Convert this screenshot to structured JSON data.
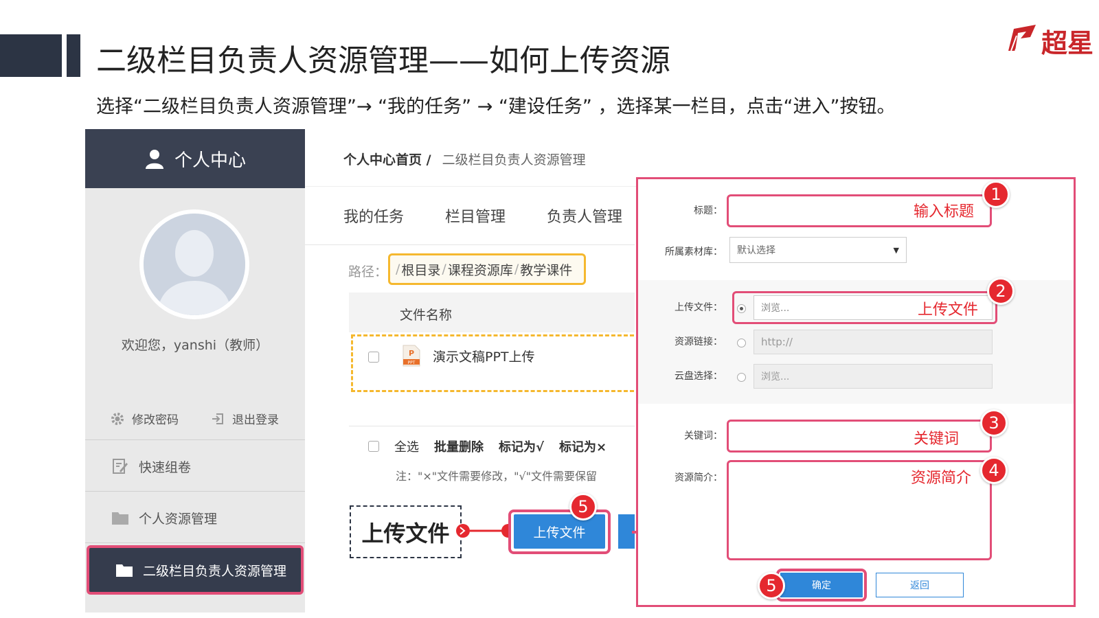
{
  "slide": {
    "title": "二级栏目负责人资源管理——如何上传资源",
    "instruction": "选择“二级栏目负责人资源管理”→ “我的任务” → “建设任务” ，选择某一栏目，点击“进入”按钮。",
    "logo_text": "超星",
    "brand_color": "#c9262a"
  },
  "sidebar": {
    "header": "个人中心",
    "welcome": "欢迎您，yanshi（教师）",
    "change_password": "修改密码",
    "logout": "退出登录",
    "items": [
      {
        "label": "快速组卷",
        "icon": "edit-icon"
      },
      {
        "label": "个人资源管理",
        "icon": "folder-icon"
      },
      {
        "label": "二级栏目负责人资源管理",
        "icon": "folder-icon",
        "active": true
      }
    ]
  },
  "breadcrumb": {
    "home": "个人中心首页 /",
    "current": "二级栏目负责人资源管理"
  },
  "tabs": [
    "我的任务",
    "栏目管理",
    "负责人管理"
  ],
  "path": {
    "label": "路径：",
    "segments": [
      "根目录",
      "课程资源库",
      "教学课件"
    ]
  },
  "file_table": {
    "column": "文件名称",
    "rows": [
      {
        "name": "演示文稿PPT上传",
        "type": "PPT"
      }
    ]
  },
  "bulk": {
    "select_all": "全选",
    "batch_delete": "批量删除",
    "mark_check": "标记为√",
    "mark_cross": "标记为×",
    "note": "注：\"×\"文件需要修改，\"√\"文件需要保留"
  },
  "callout_upload": "上传文件",
  "upload_button": "上传文件",
  "dialog": {
    "title_label": "标题：",
    "title_hint": "输入标题",
    "library_label": "所属素材库：",
    "library_value": "默认选择",
    "upload_label": "上传文件：",
    "upload_placeholder": "浏览...",
    "upload_hint": "上传文件",
    "link_label": "资源链接：",
    "link_value": "http://",
    "cloud_label": "云盘选择：",
    "cloud_value": "浏览...",
    "keyword_label": "关键词：",
    "keyword_hint": "关键词",
    "intro_label": "资源简介：",
    "intro_hint": "资源简介",
    "confirm": "确定",
    "back": "返回"
  },
  "steps": [
    "1",
    "2",
    "3",
    "4",
    "5",
    "5"
  ],
  "colors": {
    "highlight": "#e24d77",
    "step_badge": "#e5282f",
    "primary_button": "#2f87d9",
    "sidebar_dark": "#3a4152",
    "path_highlight": "#f5b82e"
  }
}
